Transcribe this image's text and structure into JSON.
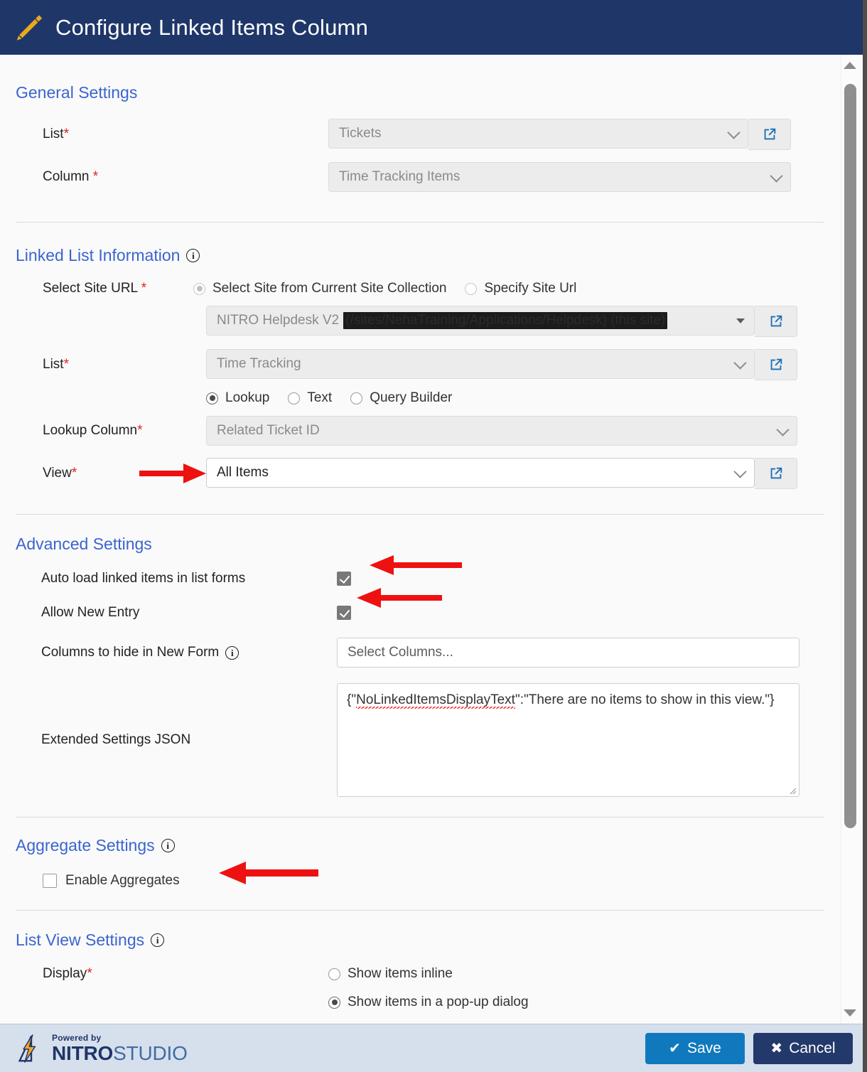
{
  "header": {
    "title": "Configure Linked Items Column",
    "icon": "pencil-icon",
    "bg_color": "#1f3668",
    "icon_color": "#e8a91d"
  },
  "sections": {
    "general": {
      "title": "General Settings",
      "list_label": "List",
      "list_value": "Tickets",
      "column_label": "Column",
      "column_value": "Time Tracking Items"
    },
    "linked_list": {
      "title": "Linked List Information",
      "site_url_label": "Select Site URL",
      "radio_current_collection": "Select Site from Current Site Collection",
      "radio_specify_url": "Specify Site Url",
      "site_value_visible": "NITRO Helpdesk V2",
      "site_value_redacted": "(/sites/NehaTraining/Applications/Helpdesk) (this site)",
      "list_label": "List",
      "list_value": "Time Tracking",
      "mode_lookup": "Lookup",
      "mode_text": "Text",
      "mode_query_builder": "Query Builder",
      "lookup_column_label": "Lookup Column",
      "lookup_column_value": "Related Ticket ID",
      "view_label": "View",
      "view_value": "All Items"
    },
    "advanced": {
      "title": "Advanced Settings",
      "auto_load_label": "Auto load linked items in list forms",
      "allow_new_entry_label": "Allow New Entry",
      "columns_hide_label": "Columns to hide in New Form",
      "columns_hide_placeholder": "Select Columns...",
      "extended_json_label": "Extended Settings JSON",
      "extended_json_part1": "{\"",
      "extended_json_key": "NoLinkedItemsDisplayText",
      "extended_json_part2": "\":\"There are no items to show in this view.\"}"
    },
    "aggregate": {
      "title": "Aggregate Settings",
      "enable_label": "Enable Aggregates"
    },
    "list_view": {
      "title": "List View Settings",
      "display_label": "Display",
      "option_inline": "Show items inline",
      "option_popup": "Show items in a pop-up dialog"
    }
  },
  "footer": {
    "powered_by": "Powered by",
    "brand_nitro": "NITRO",
    "brand_studio": "STUDIO",
    "save_label": "Save",
    "cancel_label": "Cancel",
    "save_glyph": "✔",
    "cancel_glyph": "✖",
    "save_color": "#1079bd",
    "cancel_color": "#23386b"
  },
  "annotations": {
    "arrow_color": "#ee1111",
    "count": 4
  }
}
